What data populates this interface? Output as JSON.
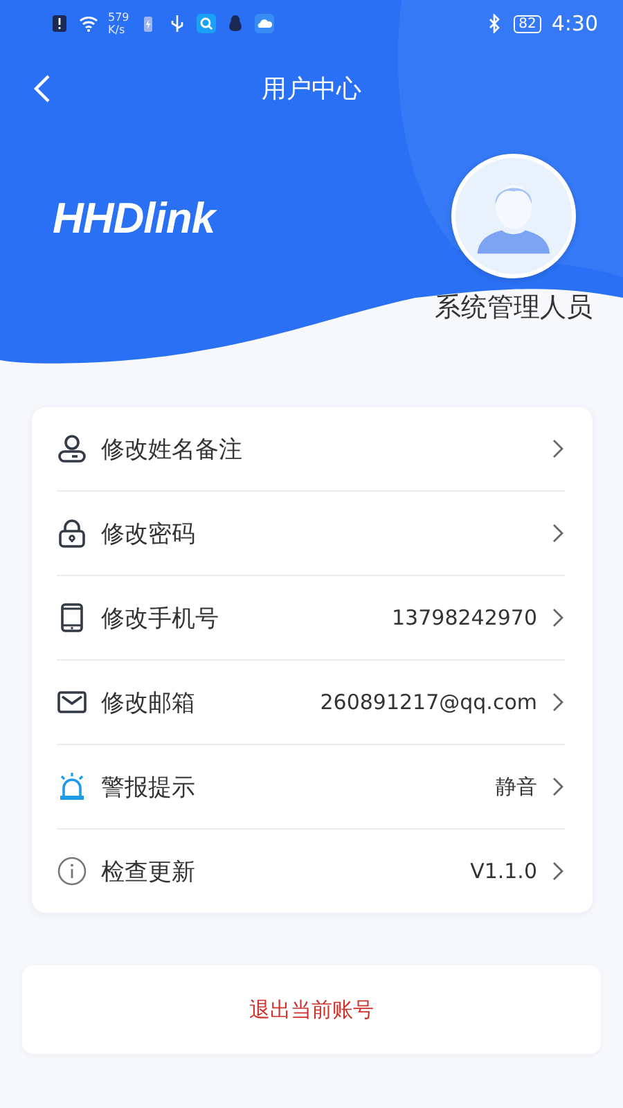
{
  "status_bar": {
    "speed_value": "579",
    "speed_unit": "K/s",
    "battery": "82",
    "time": "4:30"
  },
  "header": {
    "title": "用户中心",
    "logo": "HHDlink"
  },
  "profile": {
    "name": "系统管理人员"
  },
  "menu": [
    {
      "kind": "person",
      "label": "修改姓名备注"
    },
    {
      "kind": "lock",
      "label": "修改密码"
    },
    {
      "kind": "phone",
      "label": "修改手机号",
      "value": "13798242970"
    },
    {
      "kind": "mail",
      "label": "修改邮箱",
      "value": "260891217@qq.com"
    },
    {
      "kind": "alarm",
      "label": "警报提示",
      "value": "静音"
    },
    {
      "kind": "info",
      "label": "检查更新",
      "value": "V1.1.0"
    }
  ],
  "logout": {
    "label": "退出当前账号"
  }
}
